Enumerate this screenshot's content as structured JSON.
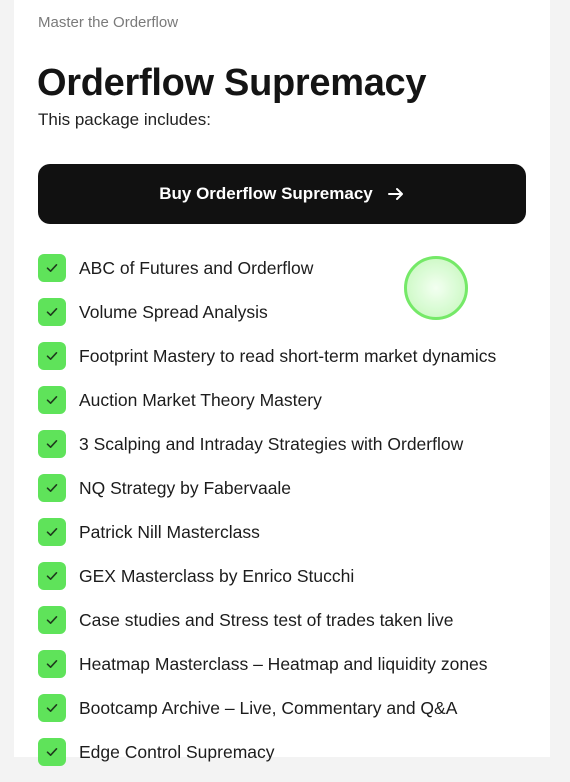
{
  "header": {
    "eyebrow": "Master the Orderflow",
    "title": "Orderflow Supremacy",
    "subtitle": "This package includes:"
  },
  "cta": {
    "label": "Buy Orderflow Supremacy",
    "icon": "arrow-right-icon"
  },
  "colors": {
    "accent": "#5fe35a",
    "button_bg": "#111111"
  },
  "features": [
    "ABC of Futures and Orderflow",
    "Volume Spread Analysis",
    "Footprint Mastery to read short-term market dynamics",
    "Auction Market Theory Mastery",
    "3 Scalping and Intraday Strategies with Orderflow",
    "NQ Strategy by Fabervaale",
    "Patrick Nill Masterclass",
    "GEX Masterclass by Enrico Stucchi",
    "Case studies and Stress test of trades taken live",
    "Heatmap Masterclass – Heatmap and liquidity zones",
    "Bootcamp Archive – Live, Commentary and Q&A",
    "Edge Control Supremacy"
  ]
}
